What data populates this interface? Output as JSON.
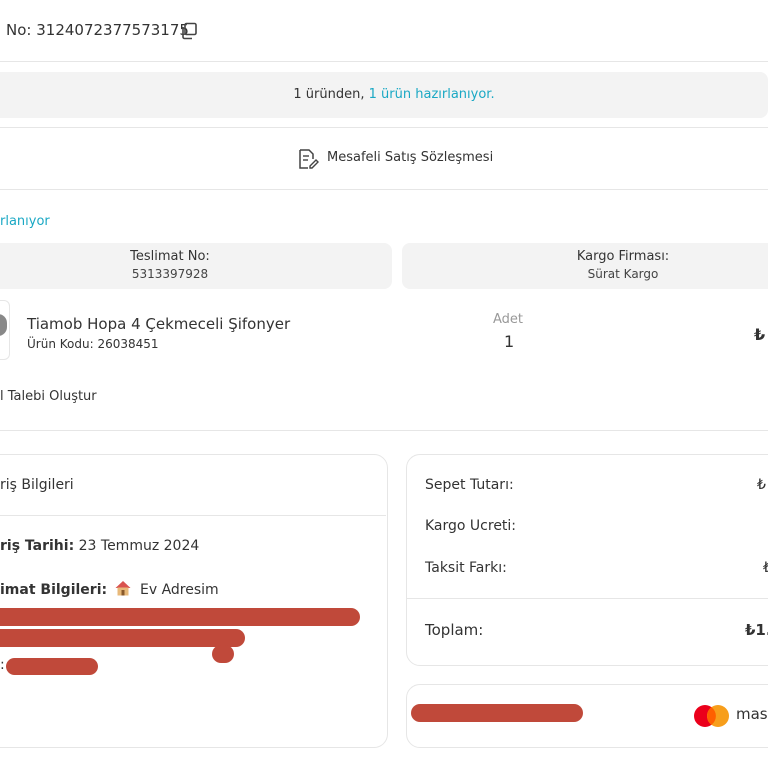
{
  "order": {
    "no_label": "No:",
    "no_value": "3124072377573175"
  },
  "status_bar": {
    "count_text": "1 üründen,",
    "status_text": "1 ürün hazırlanıyor."
  },
  "contract": {
    "label": "Mesafeli Satış Sözleşmesi"
  },
  "shipment": {
    "status_partial": "rlanıyor",
    "delivery_no_label": "Teslimat No:",
    "delivery_no_value": "5313397928",
    "carrier_label": "Kargo Firması:",
    "carrier_value": "Sürat Kargo"
  },
  "product": {
    "name": "Tiamob Hopa 4 Çekmeceli Şifonyer",
    "code_label": "Ürün Kodu:",
    "code_value": "26038451",
    "qty_label": "Adet",
    "qty_value": "1",
    "price_partial": "₺"
  },
  "request_action": {
    "label": "l Talebi Oluştur"
  },
  "order_info": {
    "title": "riş Bilgileri",
    "date_label": "riş Tarihi:",
    "date_value": "23 Temmuz 2024",
    "address_label": "imat Bilgileri:",
    "address_icon": "house-icon",
    "address_value": "Ev Adresim",
    "colon": ":"
  },
  "summary": {
    "basket_label": "Sepet Tutarı:",
    "basket_value": "₺",
    "shipping_label": "Kargo Ucreti:",
    "installment_label": "Taksit Farkı:",
    "installment_value": "₺",
    "total_label": "Toplam:",
    "total_value": "₺1."
  },
  "payment": {
    "card_brand": "mas",
    "brand_icon": "mastercard-icon"
  },
  "colors": {
    "accent": "#1aa8c4",
    "redaction": "#c0493a",
    "panel": "#f3f3f3"
  }
}
